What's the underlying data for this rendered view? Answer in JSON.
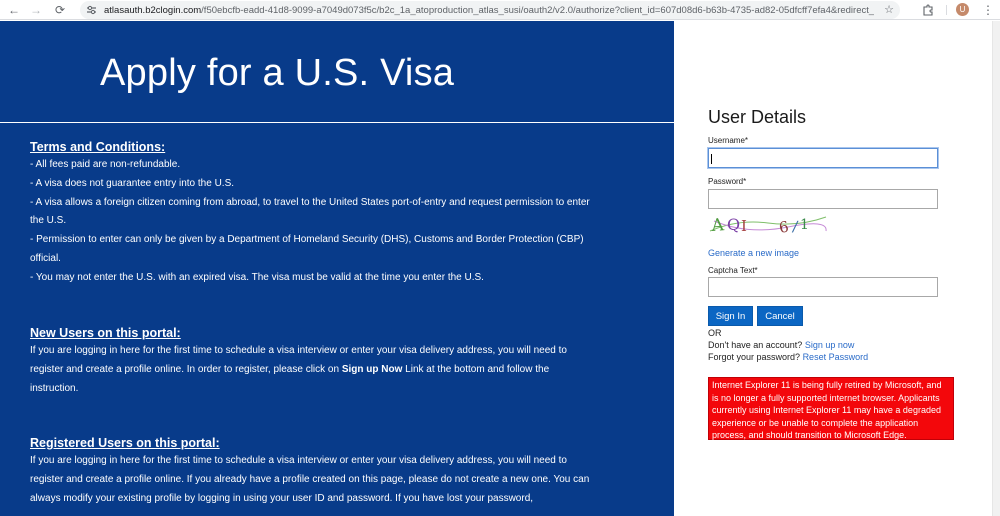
{
  "browser": {
    "url_host": "atlasauth.b2clogin.com",
    "url_rest": "/f50ebcfb-eadd-41d8-9099-a7049d073f5c/b2c_1a_atoproduction_atlas_susi/oauth2/v2.0/authorize?client_id=607d08d6-b63b-4735-ad82-05dfcff7efa4&redirect_uri=...",
    "avatar_initial": "U"
  },
  "left_panel": {
    "title": "Apply for a U.S. Visa",
    "bg_color": "#083b8a",
    "terms": {
      "title": "Terms and Conditions:",
      "lines": [
        "- All fees paid are non-refundable.",
        "- A visa does not guarantee entry into the U.S.",
        "- A visa allows a foreign citizen coming from abroad, to travel to the United States port-of-entry and request permission to enter the U.S.",
        "- Permission to enter can only be given by a Department of Homeland Security (DHS), Customs and Border Protection (CBP) official.",
        "- You may not enter the U.S. with an expired visa. The visa must be valid at the time you enter the U.S."
      ]
    },
    "new_users": {
      "title": "New Users on this portal:",
      "text_before": "If you are logging in here for the first time to schedule a visa interview or enter your visa delivery address, you will need to register and create a profile online. In order to register, please click on ",
      "bold": "Sign up Now",
      "text_after": " Link at the bottom and follow the instruction."
    },
    "registered_users": {
      "title": "Registered Users on this portal:",
      "text": "If you are logging in here for the first time to schedule a visa interview or enter your visa delivery address, you will need to register and create a profile online. If you already have a profile created on this page, please do not create a new one. You can always modify your existing profile by logging in using your user ID and password. If you have lost your password,"
    }
  },
  "form": {
    "heading": "User Details",
    "username_label": "Username*",
    "username_value": "",
    "password_label": "Password*",
    "password_value": "",
    "captcha_text": "AQI 6/1",
    "generate_link": "Generate a new image",
    "captcha_label": "Captcha Text*",
    "captcha_value": "",
    "sign_in_label": "Sign In",
    "cancel_label": "Cancel",
    "or_text": "OR",
    "no_account_text": "Don't have an account?",
    "sign_up_link": "Sign up now",
    "forgot_text": "Forgot your password?",
    "reset_link": "Reset Password",
    "warning": "Internet Explorer 11 is being fully retired by Microsoft, and is no longer a fully supported internet browser. Applicants currently using Internet Explorer 11 may have a degraded experience or be unable to complete the application process, and should transition to Microsoft Edge.",
    "accent_color": "#0b66c3",
    "warning_color": "#f3070b"
  }
}
